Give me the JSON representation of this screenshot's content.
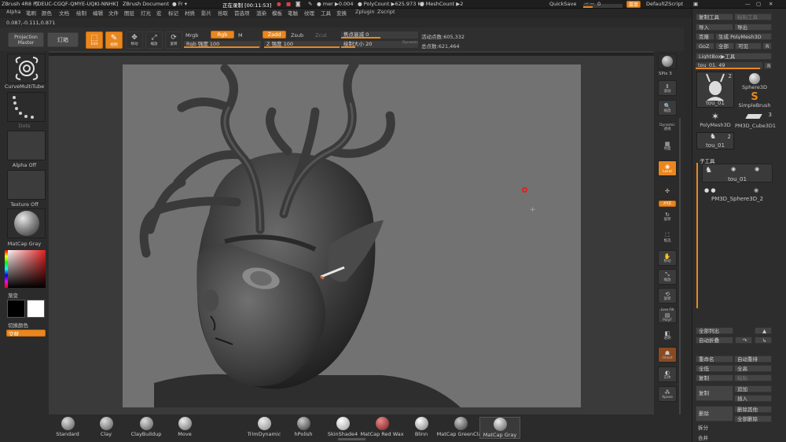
{
  "menubar": {
    "app_title": "ZBrush 4R8 P1",
    "license": "[DEUC-CGQF-QMYE-UQKI-NNHK]",
    "document": "ZBrush Document",
    "fr": "Fr",
    "recording": "正在录制 [00:11:53]",
    "mem": "mer",
    "mem_val": "0.004",
    "polycount": "PolyCount",
    "polycount_val": "625.973 KP",
    "meshcount": "MeshCount",
    "meshcount_val": "2",
    "quicksave": "QuickSave",
    "transparency_label": "透视",
    "transparency_val": "0",
    "menu_btn": "菜单",
    "default_script": "DefaultZScript"
  },
  "menus": [
    "Alpha",
    "笔刷",
    "颜色",
    "文档",
    "绘制",
    "编辑",
    "文件",
    "图层",
    "灯光",
    "宏",
    "标记",
    "材质",
    "影片",
    "拾取",
    "首选项",
    "渲染",
    "模板",
    "笔触",
    "纹理",
    "工具",
    "变换",
    "Zplugin",
    "Zscript"
  ],
  "coords": "0.087,-0.111,0.871",
  "shelf": {
    "projection_master": "Projection Master",
    "lightbox": "灯箱",
    "edit": "Edit",
    "draw": "绘制",
    "move": "移动",
    "scale": "缩放",
    "rotate": "旋转",
    "mrgb": "Mrgb",
    "rgb": "Rgb",
    "m": "M",
    "zadd": "Zadd",
    "zsub": "Zsub",
    "zcut": "Zcut",
    "rgb_intensity": "Rgb 强度 100",
    "z_intensity": "Z 强度 100",
    "focal_shift_label": "焦点衰减 0",
    "draw_size_label": "绘制大小 20",
    "dynamic": "Dynamic",
    "active_points": "活动点数:605,332",
    "total_points": "总点数:621,464"
  },
  "leftpanel": {
    "brush_name": "CurveMultiTube",
    "stroke_name": "Dots",
    "alpha_name": "Alpha Off",
    "texture_name": "Texture Off",
    "material_name": "MatCap Gray",
    "gradient_label": "渐变",
    "switch_color": "切换颜色",
    "alternate": "交替"
  },
  "rightcol": {
    "spix": "SPix 3",
    "items": [
      "滚动",
      "缩放",
      "Dynamic",
      "透视",
      "地面",
      "Local",
      "XYZ",
      "旋转",
      "框选",
      "移动",
      "缩放",
      "旋转",
      "Line Fill",
      "PolyF",
      "透明",
      "Ghost",
      "实体",
      "Xpose"
    ]
  },
  "toolpanel": {
    "copy_tool": "复制工具",
    "paste_tool": "粘贴工具",
    "import": "导入",
    "export": "导出",
    "clone": "克隆",
    "make_polymesh": "生成 PolyMesh3D",
    "goz": "GoZ",
    "all": "全部",
    "visible": "可见",
    "r": "R",
    "lightbox_tools": "LightBox▶工具",
    "current_tool": "tou_01. 49",
    "tools": [
      {
        "name": "tou_01",
        "count": "2"
      },
      {
        "name": "Sphere3D",
        "count": ""
      },
      {
        "name": "SimpleBrush",
        "count": ""
      },
      {
        "name": "PolyMesh3D",
        "count": ""
      },
      {
        "name": "PM3D_Cube3D1",
        "count": "3"
      },
      {
        "name": "tou_01",
        "count": "2"
      }
    ],
    "subtool_header": "子工具",
    "subtools": [
      "tou_01",
      "PM3D_Sphere3D_2"
    ],
    "list_all": "全部列出",
    "auto_collapse": "自动折叠",
    "rename": "重命名",
    "auto_reorder": "自动重排",
    "all_low": "全低",
    "all_high": "全高",
    "duplicate": "复制",
    "paste": "粘贴",
    "append": "追加",
    "copy2": "复制",
    "insert": "插入",
    "delete": "删除",
    "delete_other": "删除其他",
    "delete_all": "全部删除",
    "split": "拆分",
    "merge": "合并"
  },
  "brushes": [
    "Standard",
    "Clay",
    "ClayBuildup",
    "Move",
    "TrimDynamic",
    "hPolish",
    "SkinShade4",
    "MatCap Red Wax",
    "Blinn",
    "MatCap GreenClay",
    "MatCap Gray"
  ],
  "colors": {
    "accent": "#e8871f",
    "bg": "#2a2a2a",
    "canvas": "#727272",
    "primary": "#000000",
    "secondary": "#ffffff"
  }
}
